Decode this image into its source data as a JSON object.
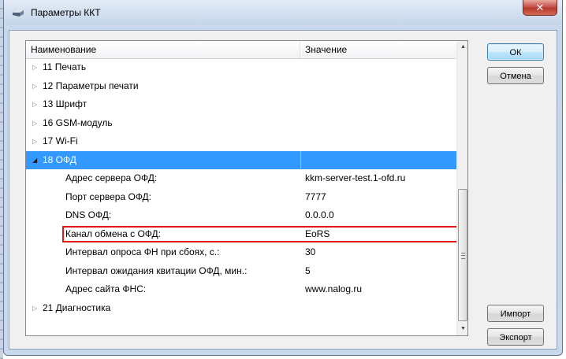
{
  "window": {
    "title": "Параметры ККТ",
    "close_glyph": "✕"
  },
  "table": {
    "columns": {
      "name": "Наименование",
      "value": "Значение"
    },
    "rows": [
      {
        "name": "11 Печать",
        "value": "",
        "type": "group",
        "expanded": false
      },
      {
        "name": "12 Параметры печати",
        "value": "",
        "type": "group",
        "expanded": false
      },
      {
        "name": "13 Шрифт",
        "value": "",
        "type": "group",
        "expanded": false
      },
      {
        "name": "16 GSM-модуль",
        "value": "",
        "type": "group",
        "expanded": false
      },
      {
        "name": "17 Wi-Fi",
        "value": "",
        "type": "group",
        "expanded": false
      },
      {
        "name": "18 ОФД",
        "value": "",
        "type": "group",
        "expanded": true,
        "selected": true
      },
      {
        "name": "Адрес сервера ОФД:",
        "value": "kkm-server-test.1-ofd.ru",
        "type": "child"
      },
      {
        "name": "Порт сервера ОФД:",
        "value": "7777",
        "type": "child"
      },
      {
        "name": "DNS ОФД:",
        "value": "0.0.0.0",
        "type": "child"
      },
      {
        "name": "Канал обмена с ОФД:",
        "value": "EoRS",
        "type": "child",
        "highlighted": true
      },
      {
        "name": "Интервал опроса ФН при сбоях, с.:",
        "value": "30",
        "type": "child"
      },
      {
        "name": "Интервал ожидания квитации ОФД, мин.:",
        "value": "5",
        "type": "child"
      },
      {
        "name": "Адрес сайта ФНС:",
        "value": "www.nalog.ru",
        "type": "child"
      },
      {
        "name": "21 Диагностика",
        "value": "",
        "type": "group",
        "expanded": false
      }
    ]
  },
  "buttons": {
    "ok": "ОК",
    "cancel": "Отмена",
    "import": "Импорт",
    "export": "Экспорт"
  },
  "colors": {
    "selection": "#3399ff",
    "highlight_border": "#e01919"
  },
  "icons": {
    "collapsed": "collapsed-arrow-icon",
    "expanded": "expanded-arrow-icon",
    "app": "printer-icon",
    "close": "close-icon"
  }
}
